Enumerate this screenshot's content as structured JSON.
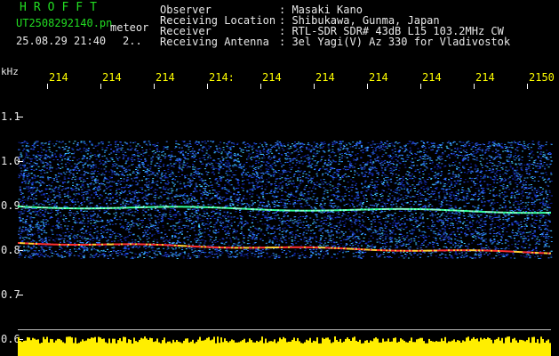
{
  "header": {
    "title": "HROFFT",
    "filename": "UT2508292140.pn",
    "mode": "meteor",
    "datetime": "25.08.29 21:40",
    "page": "2..",
    "labels": [
      "Observer",
      "Receiving Location",
      "Receiver",
      "Receiving Antenna"
    ],
    "values": [
      ": Masaki Kano",
      ": Shibukawa, Gunma, Japan",
      ": RTL-SDR SDR# 43dB L15 103.2MHz CW",
      ": 3el Yagi(V) Az 330 for Vladivostok"
    ]
  },
  "time_axis": {
    "ticks": [
      "214",
      "214",
      "214",
      "214:",
      "214",
      "214",
      "214",
      "214",
      "214",
      "2150"
    ]
  },
  "freq_axis": {
    "unit": "kHz",
    "ticks": [
      "1.1",
      "1.0",
      "0.9",
      "0.8",
      "0.7",
      "0.6"
    ]
  },
  "colors": {
    "background": "#000000",
    "noise": "#1a3cff",
    "trace_red": "#ff3030",
    "trace_green": "#33ff99",
    "bottom_bar": "#ffee00"
  }
}
